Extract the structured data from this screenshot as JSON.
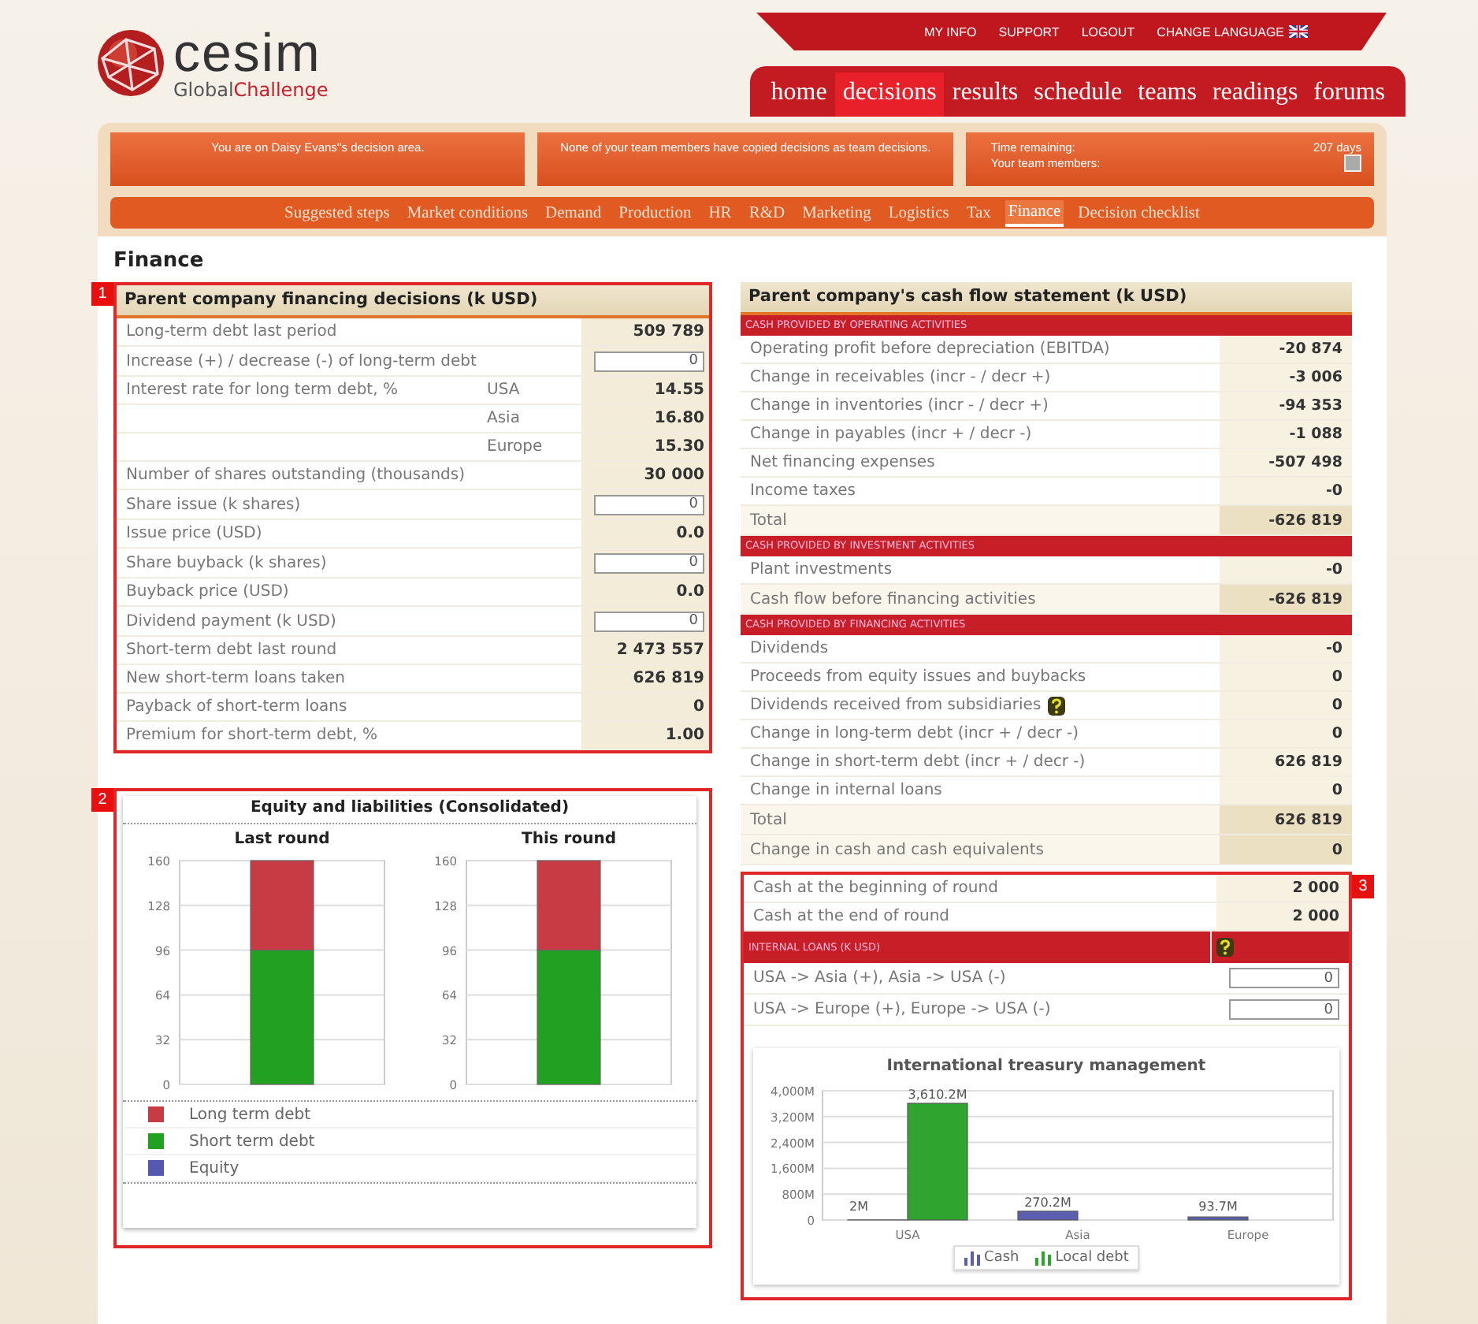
{
  "logo": {
    "name": "cesim",
    "tagline_1": "Global",
    "tagline_2": "Challenge"
  },
  "top_links": [
    {
      "label": "MY INFO"
    },
    {
      "label": "SUPPORT"
    },
    {
      "label": "LOGOUT"
    },
    {
      "label": "CHANGE LANGUAGE",
      "flag": true
    }
  ],
  "tabs": [
    {
      "label": "home",
      "selected": false
    },
    {
      "label": "decisions",
      "selected": true
    },
    {
      "label": "results",
      "selected": false
    },
    {
      "label": "schedule",
      "selected": false
    },
    {
      "label": "teams",
      "selected": false
    },
    {
      "label": "readings",
      "selected": false
    },
    {
      "label": "forums",
      "selected": false
    }
  ],
  "info_boxes": [
    {
      "text": "You are on Daisy Evans''s decision area."
    },
    {
      "text": "None of your team members have copied decisions as team decisions."
    },
    {
      "time_label": "Time remaining:",
      "time_value": "207 days",
      "members_label": "Your team members:"
    }
  ],
  "subnav": [
    {
      "label": "Suggested steps",
      "selected": false
    },
    {
      "label": "Market conditions",
      "selected": false
    },
    {
      "label": "Demand",
      "selected": false
    },
    {
      "label": "Production",
      "selected": false
    },
    {
      "label": "HR",
      "selected": false
    },
    {
      "label": "R&D",
      "selected": false
    },
    {
      "label": "Marketing",
      "selected": false
    },
    {
      "label": "Logistics",
      "selected": false
    },
    {
      "label": "Tax",
      "selected": false
    },
    {
      "label": "Finance",
      "selected": true
    },
    {
      "label": "Decision checklist",
      "selected": false
    }
  ],
  "page_title": "Finance",
  "financing": {
    "marker": "1",
    "title": "Parent company financing decisions (k USD)",
    "rows": [
      {
        "kind": "value",
        "label": "Long-term debt last period",
        "value": "509 789"
      },
      {
        "kind": "input",
        "label": "Increase (+) / decrease (-) of long-term debt",
        "value": "0"
      },
      {
        "kind": "rate",
        "label": "Interest rate for long term debt, %",
        "region": "USA",
        "value": "14.55"
      },
      {
        "kind": "rate",
        "region": "Asia",
        "value": "16.80"
      },
      {
        "kind": "rate",
        "region": "Europe",
        "value": "15.30"
      },
      {
        "kind": "value",
        "label": "Number of shares outstanding (thousands)",
        "value": "30 000"
      },
      {
        "kind": "input",
        "label": "Share issue (k shares)",
        "value": "0"
      },
      {
        "kind": "value",
        "label": "Issue price (USD)",
        "value": "0.0"
      },
      {
        "kind": "input",
        "label": "Share buyback (k shares)",
        "value": "0"
      },
      {
        "kind": "value",
        "label": "Buyback price (USD)",
        "value": "0.0"
      },
      {
        "kind": "input",
        "label": "Dividend payment (k USD)",
        "value": "0"
      },
      {
        "kind": "value",
        "label": "Short-term debt last round",
        "value": "2 473 557"
      },
      {
        "kind": "value",
        "label": "New short-term loans taken",
        "value": "626 819"
      },
      {
        "kind": "value",
        "label": "Payback of short-term loans",
        "value": "0"
      },
      {
        "kind": "value",
        "label": "Premium for short-term debt, %",
        "value": "1.00"
      }
    ]
  },
  "equity_panel": {
    "marker": "2",
    "title": "Equity and liabilities (Consolidated)",
    "charts": [
      {
        "chart_data": {
          "type": "bar",
          "title": "Last round",
          "stacked": true,
          "grid": true,
          "ylim": [
            0,
            160
          ],
          "yticks": [
            0,
            32,
            64,
            96,
            128,
            160
          ],
          "legend": true,
          "series": [
            {
              "name": "Long term debt",
              "color": "#c83a44",
              "values": [
                64
              ]
            },
            {
              "name": "Short term debt",
              "color": "#22a022",
              "values": [
                96
              ]
            },
            {
              "name": "Equity",
              "color": "#5558b0",
              "values": [
                0
              ]
            }
          ]
        }
      },
      {
        "chart_data": {
          "type": "bar",
          "title": "This round",
          "stacked": true,
          "grid": true,
          "ylim": [
            0,
            160
          ],
          "yticks": [
            0,
            32,
            64,
            96,
            128,
            160
          ],
          "series": [
            {
              "color": "#c83a44",
              "values": [
                64
              ]
            },
            {
              "color": "#22a022",
              "values": [
                96
              ]
            }
          ]
        }
      }
    ]
  },
  "cash_flow": {
    "title": "Parent company's cash flow statement (k USD)",
    "rows": [
      {
        "kind": "section",
        "label": "CASH PROVIDED BY OPERATING ACTIVITIES"
      },
      {
        "kind": "row",
        "label": "Operating profit before depreciation (EBITDA)",
        "value": "-20 874"
      },
      {
        "kind": "row",
        "label": "Change in receivables (incr - / decr +)",
        "value": "-3 006"
      },
      {
        "kind": "row",
        "label": "Change in inventories (incr - / decr +)",
        "value": "-94 353"
      },
      {
        "kind": "row",
        "label": "Change in payables (incr + / decr -)",
        "value": "-1 088"
      },
      {
        "kind": "row",
        "label": "Net financing expenses",
        "value": "-507 498"
      },
      {
        "kind": "row",
        "label": "Income taxes",
        "value": "-0"
      },
      {
        "kind": "total",
        "label": "Total",
        "value": "-626 819"
      },
      {
        "kind": "section",
        "label": "CASH PROVIDED BY INVESTMENT ACTIVITIES"
      },
      {
        "kind": "row",
        "label": "Plant investments",
        "value": "-0"
      },
      {
        "kind": "total",
        "label": "Cash flow before financing activities",
        "value": "-626 819"
      },
      {
        "kind": "section",
        "label": "CASH PROVIDED BY FINANCING ACTIVITIES"
      },
      {
        "kind": "row",
        "label": "Dividends",
        "value": "-0"
      },
      {
        "kind": "row",
        "label": "Proceeds from equity issues and buybacks",
        "value": "0"
      },
      {
        "kind": "row",
        "label": "Dividends received from subsidiaries",
        "value": "0",
        "help": true
      },
      {
        "kind": "row",
        "label": "Change in long-term debt (incr + / decr -)",
        "value": "0"
      },
      {
        "kind": "row",
        "label": "Change in short-term debt (incr + / decr -)",
        "value": "626 819"
      },
      {
        "kind": "row",
        "label": "Change in internal loans",
        "value": "0"
      },
      {
        "kind": "total",
        "label": "Total",
        "value": "626 819"
      },
      {
        "kind": "total",
        "label": "Change in cash and cash equivalents",
        "value": "0"
      }
    ]
  },
  "treasury": {
    "marker": "3",
    "rows": [
      {
        "kind": "row",
        "label": "Cash at the beginning of round",
        "value": "2 000"
      },
      {
        "kind": "row",
        "label": "Cash at the end of round",
        "value": "2 000"
      },
      {
        "kind": "section",
        "label": "INTERNAL LOANS (K USD)",
        "help": true
      },
      {
        "kind": "input",
        "label": "USA -> Asia (+), Asia -> USA (-)",
        "value": "0"
      },
      {
        "kind": "input",
        "label": "USA -> Europe (+), Europe -> USA (-)",
        "value": "0"
      }
    ],
    "chart_data": {
      "type": "bar",
      "title": "International treasury management",
      "grid": true,
      "legend": true,
      "categories": [
        "USA",
        "Asia",
        "Europe"
      ],
      "ylim": [
        0,
        4000
      ],
      "yticks": [
        {
          "value": 0,
          "label": "0"
        },
        {
          "value": 800,
          "label": "800M"
        },
        {
          "value": 1600,
          "label": "1,600M"
        },
        {
          "value": 2400,
          "label": "2,400M"
        },
        {
          "value": 3200,
          "label": "3,200M"
        },
        {
          "value": 4000,
          "label": "4,000M"
        }
      ],
      "value_labels": [
        [
          "2M",
          "270.2M",
          "93.7M"
        ],
        [
          "3,610.2M",
          null,
          null
        ]
      ],
      "series": [
        {
          "name": "Cash",
          "color": "#5a5fb0",
          "values": [
            2,
            270,
            94
          ]
        },
        {
          "name": "Local debt",
          "color": "#2fa52f",
          "values": [
            3610,
            0,
            0
          ]
        }
      ]
    }
  }
}
